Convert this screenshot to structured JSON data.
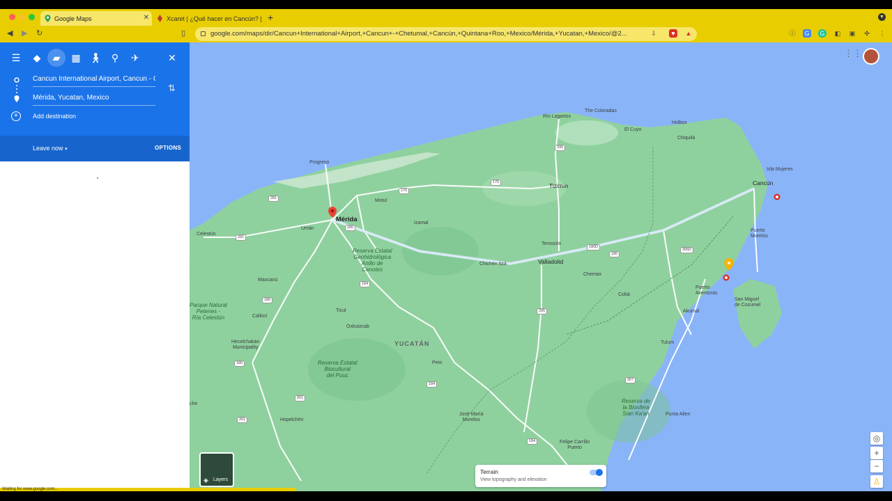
{
  "browser": {
    "tabs": [
      {
        "title": "Google Maps",
        "active": true
      },
      {
        "title": "Xcaret | ¿Qué hacer en Cancún? | P",
        "active": false
      }
    ],
    "url": "google.com/maps/dir/Cancun+International+Airport,+Cancun+-+Chetumal,+Cancún,+Quintana+Roo,+Mexico/Mérida,+Yucatan,+Mexico/@2...",
    "accent_color": "#e8cd00"
  },
  "sidebar": {
    "travel_modes": [
      "directions-icon",
      "car-icon",
      "transit-icon",
      "walk-icon",
      "bike-icon",
      "flight-icon"
    ],
    "selected_mode": "car-icon",
    "origin": "Cancun International Airport, Cancun - C",
    "destination": "Mérida, Yucatan, Mexico",
    "add_destination": "Add destination",
    "leave_now": "Leave now",
    "options": "OPTIONS"
  },
  "map": {
    "terrain_title": "Terrain",
    "terrain_sub": "View topography and elevation",
    "terrain_enabled": true,
    "layers_label": "Layers",
    "places": {
      "merida": "Mérida",
      "cancun": "Cancún",
      "valladolid": "Valladolid",
      "tizimin": "Tizimín",
      "progreso": "Progreso",
      "isla_mujeres": "Isla Mujeres",
      "puerto_morelos": "Puerto\nMorelos",
      "puerto_aventuras": "Puerto\nAventuras",
      "san_miguel": "San Miguel\nde Cozumel",
      "akumal": "Akumal",
      "tulum": "Tulum",
      "chemax": "Chemax",
      "coba": "Cobá",
      "chichen": "Chichén Itzá",
      "temozon": "Temozón",
      "izamal": "Izamal",
      "motul": "Motul",
      "uman": "Umán",
      "celestun": "Celestún",
      "maxcanu": "Maxcanú",
      "calkini": "Calkiní",
      "ticul": "Ticul",
      "oxkutzcab": "Oxkutzcab",
      "peto": "Peto",
      "hecelchakan": "Hecelchakán\nMunicipality",
      "hopelchen": "Hopelchén",
      "jose_maria": "José María\nMorelos",
      "felipe": "Felipe Carrillo\nPuerto",
      "punta_allen": "Punta Allen",
      "rio_lagartos": "Río Lagartos",
      "the_coloradas": "The Coloradas",
      "el_cuyo": "El Cuyo",
      "holbox": "Holbox",
      "chiquila": "Chiquilá",
      "che": "che"
    },
    "reserves": {
      "geohidrologica": "Reserva Estatal\nGeohidrológica\nAnillo de\nCenotes",
      "biocultural": "Reserva Estatal\nBiocultural\ndel Puuc",
      "celestun_park": "Parque Natural\nPetenes -\nRía Celestún",
      "sian_kaan": "Reserva de\nla Biosfera\nSian Ka'an"
    },
    "region": "YUCATÁN",
    "road_shields": [
      "295",
      "176",
      "175",
      "281",
      "180",
      "184",
      "281",
      "180",
      "261",
      "180",
      "184",
      "295",
      "180D",
      "180",
      "305D",
      "307",
      "184",
      "261"
    ]
  },
  "status_text": "Waiting for www.google.com..."
}
